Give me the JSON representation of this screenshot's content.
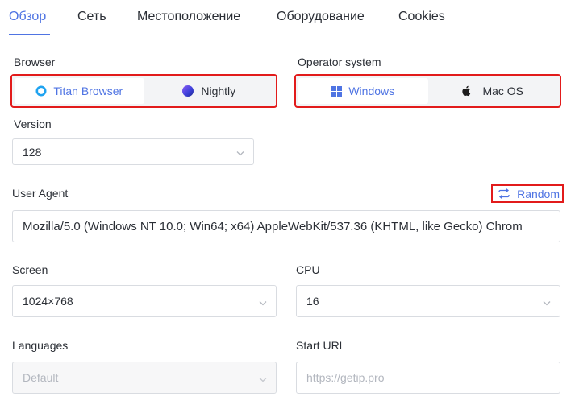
{
  "tabs": [
    {
      "label": "Обзор"
    },
    {
      "label": "Сеть"
    },
    {
      "label": "Местоположение"
    },
    {
      "label": "Оборудование"
    },
    {
      "label": "Cookies"
    }
  ],
  "browser": {
    "label": "Browser",
    "options": [
      {
        "label": "Titan Browser",
        "icon": "titan-browser-icon"
      },
      {
        "label": "Nightly",
        "icon": "nightly-icon"
      }
    ],
    "selected": "Titan Browser"
  },
  "os": {
    "label": "Operator system",
    "options": [
      {
        "label": "Windows",
        "icon": "windows-icon"
      },
      {
        "label": "Mac OS",
        "icon": "apple-icon"
      }
    ],
    "selected": "Windows"
  },
  "version": {
    "label": "Version",
    "value": "128"
  },
  "user_agent": {
    "label": "User Agent",
    "random_label": "Random",
    "value": "Mozilla/5.0 (Windows NT 10.0; Win64; x64) AppleWebKit/537.36 (KHTML, like Gecko) Chrom"
  },
  "screen": {
    "label": "Screen",
    "value": "1024×768"
  },
  "cpu": {
    "label": "CPU",
    "value": "16"
  },
  "languages": {
    "label": "Languages",
    "value": "Default"
  },
  "start_url": {
    "label": "Start URL",
    "placeholder": "https://getip.pro"
  },
  "colors": {
    "accent": "#4f74e3",
    "highlight_border": "#e21b1b"
  }
}
